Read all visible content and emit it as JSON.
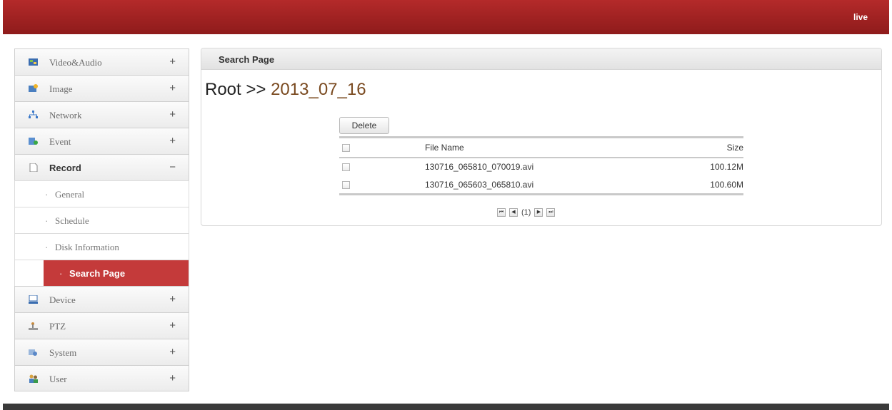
{
  "header": {
    "live_label": "live",
    "accent": "#a32323"
  },
  "sidebar": {
    "items": [
      {
        "label": "Video&Audio",
        "icon": "video-audio-icon",
        "sign": "+"
      },
      {
        "label": "Image",
        "icon": "image-icon",
        "sign": "+"
      },
      {
        "label": "Network",
        "icon": "network-icon",
        "sign": "+"
      },
      {
        "label": "Event",
        "icon": "event-icon",
        "sign": "+"
      },
      {
        "label": "Record",
        "icon": "record-icon",
        "sign": "−"
      },
      {
        "label": "Device",
        "icon": "device-icon",
        "sign": "+"
      },
      {
        "label": "PTZ",
        "icon": "ptz-icon",
        "sign": "+"
      },
      {
        "label": "System",
        "icon": "system-icon",
        "sign": "+"
      },
      {
        "label": "User",
        "icon": "user-icon",
        "sign": "+"
      }
    ],
    "record_sub": [
      {
        "label": "General"
      },
      {
        "label": "Schedule"
      },
      {
        "label": "Disk Information"
      },
      {
        "label": "Search Page"
      }
    ],
    "active_sub": "Search Page",
    "active_color": "#c43a3a"
  },
  "panel": {
    "title": "Search Page",
    "breadcrumb_root": "Root",
    "breadcrumb_sep": ">>",
    "breadcrumb_folder": "2013_07_16",
    "delete_label": "Delete",
    "columns": {
      "name": "File Name",
      "size": "Size"
    },
    "files": [
      {
        "name": "130716_065810_070019.avi",
        "size": "100.12M"
      },
      {
        "name": "130716_065603_065810.avi",
        "size": "100.60M"
      }
    ],
    "pager": {
      "first": "⏮",
      "prev": "◀",
      "page": "(1)",
      "next": "▶",
      "last": "⏭"
    }
  }
}
